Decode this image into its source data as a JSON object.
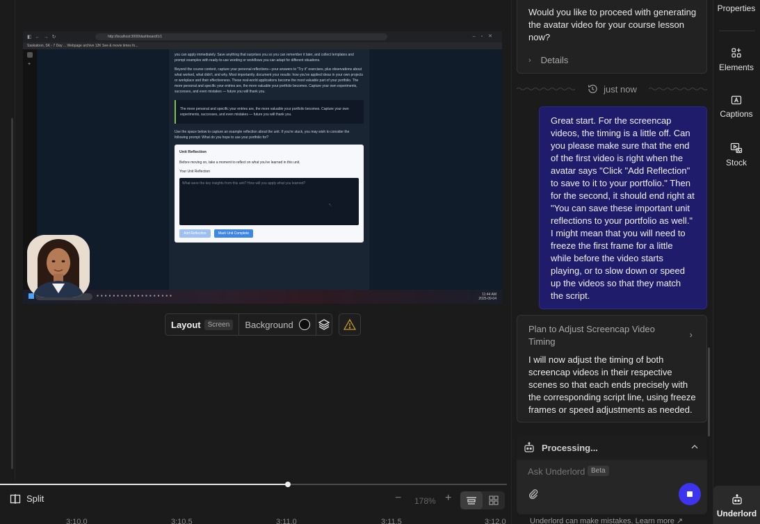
{
  "video": {
    "browser_url": "http://localhost:3000/dashboard/1/1",
    "bookmarks": "Saskatoon, SK - 7 Day ...   Webpage archive   12K   See & movie times fo...",
    "page_paragraphs": [
      "you can apply immediately. Save anything that surprises you so you can remember it later, and collect templates and prompt examples with ready-to-use wording or workflows you can adapt for different situations.",
      "Beyond the course content, capture your personal reflections—your answers to \"Try it\" exercises, plus observations about what worked, what didn't, and why. Most importantly, document your results: how you've applied ideas in your own projects or workplace and their effectiveness. These real-world applications become the most valuable part of your portfolio. The more personal and specific your entries are, the more valuable your portfolio becomes. Capture your own experiments, successes, and even mistakes — future you will thank you."
    ],
    "quote": "The more personal and specific your entries are, the more valuable your portfolio becomes. Capture your own experiments, successes, and even mistakes — future you will thank you.",
    "prompt_text": "Use the space below to capture an example reflection about the unit. If you're stuck, you may wish to consider the following prompt: What do you hope to use your portfolio for?",
    "reflection": {
      "title": "Unit Reflection",
      "intro": "Before moving on, take a moment to reflect on what you've learned in this unit.",
      "field_label": "Your Unit Reflection",
      "placeholder": "What were the key insights from this unit? How will you apply what you learned?",
      "add_button": "Add Reflection",
      "complete_button": "Mark Unit Complete"
    },
    "clock_time": "11:44 AM",
    "clock_date": "2025-09-04"
  },
  "toolbar": {
    "layout_label": "Layout",
    "layout_value": "Screen",
    "background_label": "Background"
  },
  "timeline": {
    "split_label": "Split",
    "zoom_minus": "−",
    "zoom_level": "178%",
    "zoom_plus": "+",
    "progress": 0.57,
    "ticks": [
      "3:10.0",
      "3:10.5",
      "3:11.0",
      "3:11.5",
      "3:12.0"
    ]
  },
  "chat": {
    "question": "Would you like to proceed with generating the avatar video for your course lesson now?",
    "details_label": "Details",
    "timestamp": "just now",
    "user_message": "Great start. For the screencap videos, the timing is a little off. Can you please make sure that the end of the first video is right when the avatar says \"Click \"Add Reflection\" to save to it to your portfolio.\" Then for the second, it should end right at \"You can save these important unit reflections to your portfolio as well.\" I might mean that you will need to freeze the first frame for a little while before the video starts playing, or to slow down or speed up the videos so that they match the script.",
    "plan_title": "Plan to Adjust Screencap Video Timing",
    "plan_body": "I will now adjust the timing of both screencap videos in their respective scenes so that each ends precisely with the corresponding script line, using freeze frames or speed adjustments as needed.",
    "processing_label": "Processing...",
    "input_placeholder": "Ask Underlord",
    "beta_label": "Beta",
    "disclaimer": "Underlord can make mistakes. Learn more ↗"
  },
  "rail": {
    "properties": "Properties",
    "elements": "Elements",
    "captions": "Captions",
    "stock": "Stock",
    "underlord": "Underlord"
  },
  "colors": {
    "accent": "#3c34ef",
    "user_bubble": "#1f1d6b",
    "warning": "#c79a2a"
  }
}
